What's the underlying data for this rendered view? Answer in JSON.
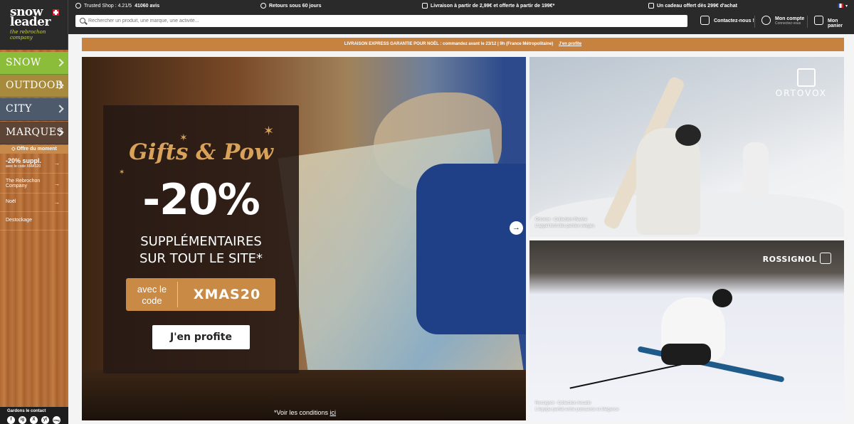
{
  "logo": {
    "brand": "snow leader",
    "tagline": "the rebrochon company"
  },
  "topbar": {
    "trusted": {
      "label": "Trusted Shop : 4.21/5",
      "reviews": "41060 avis"
    },
    "returns": "Retours sous 60 jours",
    "shipping": "Livraison à partir de 2,99€ et offerte à partir de 199€*",
    "gift": "Un cadeau offert dès 299€ d'achat",
    "search_placeholder": "Rechercher un produit, une marque, une activité...",
    "contact": "Contactez-nous !",
    "account": "Mon compte",
    "account_sub": "Connectez-vous",
    "cart": "Mon panier"
  },
  "sidebar": {
    "categories": [
      "SNOW",
      "OUTDOOR",
      "CITY",
      "MARQUES"
    ],
    "offer_title": "Offre du moment",
    "promo_big": "-20% suppl.",
    "promo_small": "avec le code XMAS20",
    "items": [
      "The Rebrochon Company",
      "Noël",
      "Destockage"
    ],
    "contact_label": "Gardons le contact",
    "socials": [
      "f",
      "ig",
      "X",
      "yt",
      "blog"
    ]
  },
  "banner": {
    "text": "LIVRAISON EXPRESS GARANTIE POUR NOËL : commandez avant le 23/12 | 9h (France Métropolitaine)",
    "link": "J'en profite"
  },
  "hero": {
    "headline": "Gifts & Pow",
    "discount": "-20%",
    "line1": "SUPPLÉMENTAIRES",
    "line2": "SUR TOUT LE SITE*",
    "code_label": "avec le code",
    "code": "XMAS20",
    "cta": "J'en profite",
    "conditions": "*Voir les conditions",
    "conditions_link": "ici"
  },
  "tiles": [
    {
      "brand": "ORTOVOX",
      "caption_1": "Ortovox - Collection Ravine",
      "caption_2": "L'appel brut des pentes vierges"
    },
    {
      "brand": "ROSSIGNOL",
      "caption_1": "Rossignol - Collection Arcade",
      "caption_2": "L'équipe parfait entre puissance et élégance"
    }
  ],
  "colors": {
    "accent": "#c8823f",
    "topbar": "#2a2a2a",
    "snow": "#8cbd3a",
    "outdoor": "#a88a3d",
    "city": "#4d5a6b",
    "marques": "#5c4436"
  }
}
